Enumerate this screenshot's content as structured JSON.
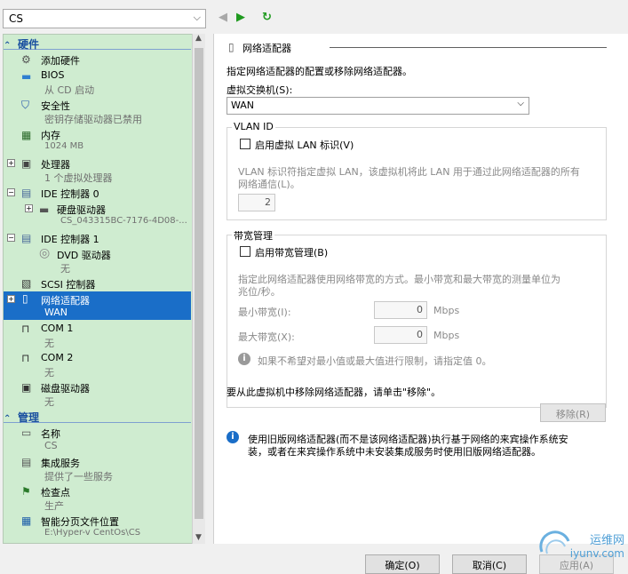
{
  "vm_selector": {
    "value": "CS"
  },
  "nav": {
    "back": "◀",
    "forward": "▶",
    "refresh": "↻"
  },
  "tree": {
    "hardware_section": "硬件",
    "management_section": "管理",
    "items": [
      {
        "title": "添加硬件",
        "sub": ""
      },
      {
        "title": "BIOS",
        "sub": "从 CD 启动"
      },
      {
        "title": "安全性",
        "sub": "密钥存储驱动器已禁用"
      },
      {
        "title": "内存",
        "sub": "1024 MB"
      },
      {
        "title": "处理器",
        "sub": "1 个虚拟处理器"
      },
      {
        "title": "IDE 控制器 0",
        "sub": ""
      },
      {
        "title": "硬盘驱动器",
        "sub": "CS_043315BC-7176-4D08-..."
      },
      {
        "title": "IDE 控制器 1",
        "sub": ""
      },
      {
        "title": "DVD 驱动器",
        "sub": "无"
      },
      {
        "title": "SCSI 控制器",
        "sub": ""
      },
      {
        "title": "网络适配器",
        "sub": "WAN"
      },
      {
        "title": "COM 1",
        "sub": "无"
      },
      {
        "title": "COM 2",
        "sub": "无"
      },
      {
        "title": "磁盘驱动器",
        "sub": "无"
      }
    ],
    "mgmt_items": [
      {
        "title": "名称",
        "sub": "CS"
      },
      {
        "title": "集成服务",
        "sub": "提供了一些服务"
      },
      {
        "title": "检查点",
        "sub": "生产"
      },
      {
        "title": "智能分页文件位置",
        "sub": "E:\\Hyper-v CentOs\\CS"
      }
    ]
  },
  "panel": {
    "heading": "网络适配器",
    "description": "指定网络适配器的配置或移除网络适配器。",
    "switch_label": "虚拟交换机(S):",
    "switch_value": "WAN",
    "vlan": {
      "group": "VLAN ID",
      "checkbox": "启用虚拟 LAN 标识(V)",
      "desc1": "VLAN 标识符指定虚拟 LAN，该虚拟机将此 LAN 用于通过此网络适配器的所有",
      "desc2": "网络通信(L)。",
      "value": "2"
    },
    "bandwidth": {
      "group": "带宽管理",
      "checkbox": "启用带宽管理(B)",
      "desc1": "指定此网络适配器使用网络带宽的方式。最小带宽和最大带宽的测量单位为",
      "desc2": "兆位/秒。",
      "min_label": "最小带宽(I):",
      "min_value": "0",
      "max_label": "最大带宽(X):",
      "max_value": "0",
      "unit": "Mbps",
      "hint": "如果不希望对最小值或最大值进行限制，请指定值 0。"
    },
    "remove_text": "要从此虚拟机中移除网络适配器，请单击\"移除\"。",
    "remove_button": "移除(R)",
    "legacy1": "使用旧版网络适配器(而不是该网络适配器)执行基于网络的来宾操作系统安",
    "legacy2": "装，或者在来宾操作系统中未安装集成服务时使用旧版网络适配器。"
  },
  "buttons": {
    "ok": "确定(O)",
    "cancel": "取消(C)",
    "apply": "应用(A)"
  },
  "watermark": {
    "cn": "运维网",
    "en": "iyunv.com"
  },
  "colors": {
    "selection": "#1a6ec8",
    "tree_bg": "#cfecd0",
    "info": "#1a6ec8"
  }
}
